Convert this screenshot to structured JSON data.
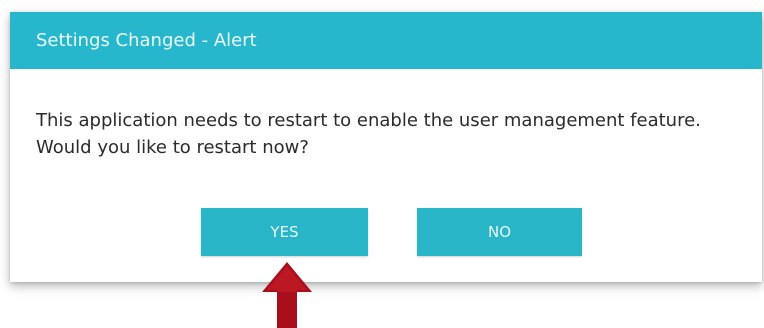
{
  "dialog": {
    "title": "Settings Changed - Alert",
    "message": "This application needs to restart to enable the user management feature. Would you like to restart now?",
    "buttons": {
      "yes_label": "YES",
      "no_label": "NO"
    }
  },
  "annotation": {
    "icon": "up-arrow-icon",
    "color": "#a90f1b"
  },
  "colors": {
    "titlebar": "#27b7cc",
    "button": "#28b5c8",
    "title_text": "#e9fafc",
    "body_text": "#2b2b2b"
  }
}
